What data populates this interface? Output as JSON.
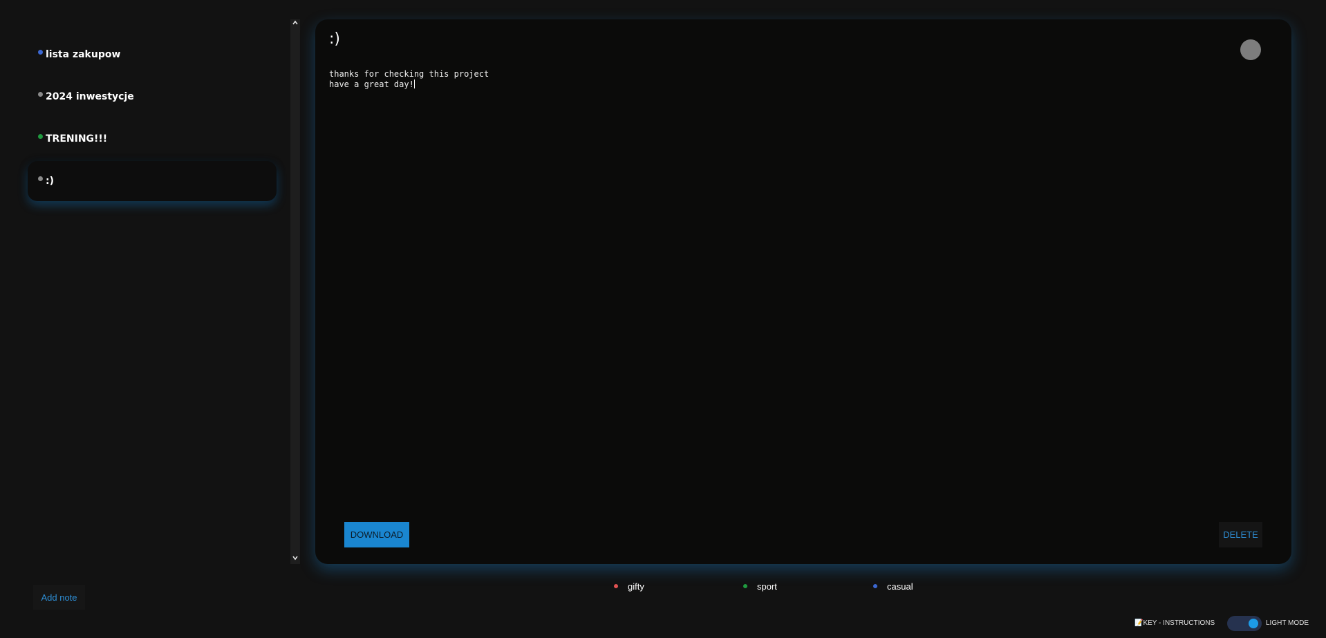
{
  "notes": [
    {
      "title": "lista zakupow",
      "dot_color": "#3b67d1"
    },
    {
      "title": "2024 inwestycje",
      "dot_color": "#8a8a8a"
    },
    {
      "title": "TRENING!!!",
      "dot_color": "#1f9a3f"
    },
    {
      "title": ":)",
      "dot_color": "#8a8a8a"
    }
  ],
  "scrollbar": {
    "up_icon": "chevron-up-icon",
    "down_icon": "chevron-down-icon"
  },
  "editor": {
    "title": ":)",
    "body_line1": "thanks for checking this project",
    "body_line2": "have a great day!",
    "color_circle": "#7d7d7d",
    "download_label": "DOWNLOAD",
    "delete_label": "DELETE"
  },
  "categories": [
    {
      "label": "gifty",
      "dot_color": "#e05252"
    },
    {
      "label": "sport",
      "dot_color": "#1f9a3f"
    },
    {
      "label": "casual",
      "dot_color": "#3b67d1"
    }
  ],
  "add_note_label": "Add note",
  "footer": {
    "key_instructions_label": "📝KEY - INSTRUCTIONS",
    "light_mode_label": "LIGHT MODE"
  },
  "colors": {
    "background": "#121212",
    "panel": "#0b0b0a",
    "accent": "#1a86d0",
    "glow": "#1e8cdc"
  }
}
